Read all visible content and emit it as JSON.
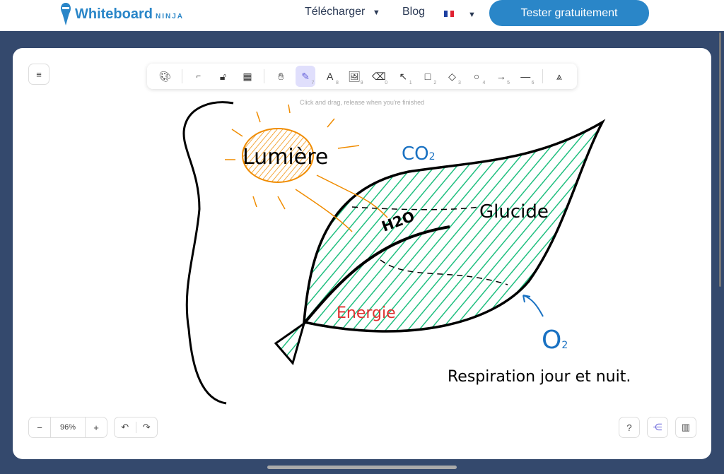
{
  "header": {
    "logo_main": "Whiteboard",
    "logo_sub": "NINJA",
    "nav": [
      {
        "label": "Télécharger"
      },
      {
        "label": "Blog"
      }
    ],
    "language": "FR",
    "cta": "Tester gratuitement"
  },
  "toolbar": {
    "tools": [
      {
        "icon": "palette-icon"
      },
      {
        "icon": "pen-settings-icon"
      },
      {
        "icon": "lock-icon"
      },
      {
        "icon": "grid-icon"
      },
      {
        "icon": "hand-icon"
      },
      {
        "icon": "pencil-icon",
        "key": "7",
        "selected": true
      },
      {
        "icon": "text-icon",
        "key": "8"
      },
      {
        "icon": "image-icon",
        "key": "9"
      },
      {
        "icon": "eraser-icon",
        "key": "0"
      },
      {
        "icon": "pointer-icon",
        "key": "1"
      },
      {
        "icon": "rectangle-icon",
        "key": "2"
      },
      {
        "icon": "diamond-icon",
        "key": "3"
      },
      {
        "icon": "circle-icon",
        "key": "4"
      },
      {
        "icon": "arrow-icon",
        "key": "5"
      },
      {
        "icon": "line-icon",
        "key": "6"
      },
      {
        "icon": "compass-icon"
      }
    ],
    "hint": "Click and drag, release when you're finished"
  },
  "drawing": {
    "sun_label": "Lumière",
    "co2": "CO",
    "co2_sub": "2",
    "h2o": "H2O",
    "glucide": "Glucide",
    "energie": "Energie",
    "o2": "O",
    "o2_sub": "2",
    "caption": "Respiration jour et nuit."
  },
  "zoom": {
    "value": "96%",
    "minus": "−",
    "plus": "+"
  },
  "colors": {
    "accent": "#2a86c8",
    "leaf": "#1fbf7f",
    "sun": "#f08c00",
    "energie": "#e03131",
    "o2": "#1971c2"
  }
}
